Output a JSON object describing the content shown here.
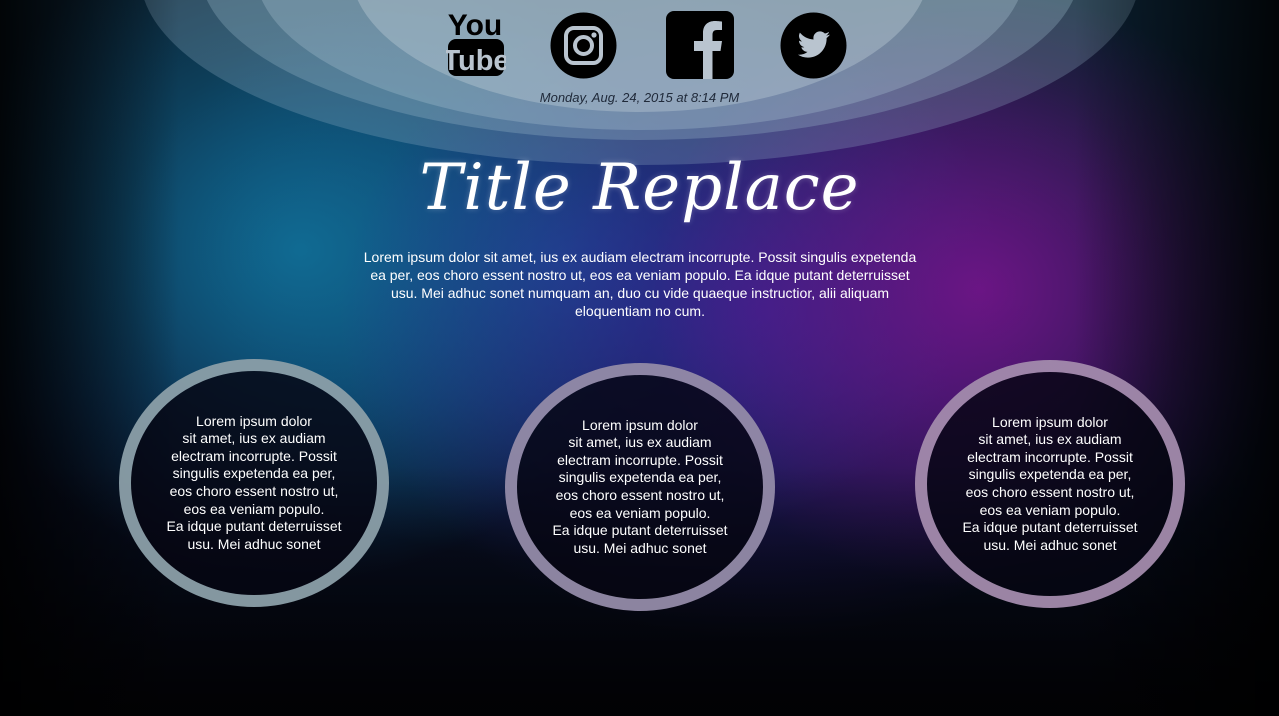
{
  "social": {
    "youtube": {
      "icon": "youtube-icon",
      "label_top": "You",
      "label_bottom": "Tube"
    },
    "instagram": {
      "icon": "instagram-icon"
    },
    "facebook": {
      "icon": "facebook-icon"
    },
    "twitter": {
      "icon": "twitter-icon"
    }
  },
  "header": {
    "timestamp": "Monday, Aug. 24, 2015 at 8:14 PM",
    "title": "Title Replace"
  },
  "intro": {
    "text": "Lorem ipsum dolor sit amet, ius ex audiam electram incorrupte. Possit singulis expetenda ea per, eos choro essent nostro ut, eos ea veniam populo. Ea idque putant deterruisset usu. Mei adhuc sonet numquam an, duo cu vide quaeque instructior, alii aliquam eloquentiam no cum."
  },
  "circles": [
    {
      "lines": [
        "Lorem ipsum dolor",
        "sit amet, ius ex audiam",
        "electram incorrupte. Possit",
        "singulis expetenda ea per,",
        "eos choro essent nostro ut,",
        "eos ea veniam populo.",
        "Ea idque putant deterruisset",
        "usu. Mei adhuc sonet"
      ]
    },
    {
      "lines": [
        "Lorem ipsum dolor",
        "sit amet, ius ex audiam",
        "electram incorrupte. Possit",
        "singulis expetenda ea per,",
        "eos choro essent nostro ut,",
        "eos ea veniam populo.",
        "Ea idque putant deterruisset",
        "usu. Mei adhuc sonet"
      ]
    },
    {
      "lines": [
        "Lorem ipsum dolor",
        "sit amet, ius ex audiam",
        "electram incorrupte. Possit",
        "singulis expetenda ea per,",
        "eos choro essent nostro ut,",
        "eos ea veniam populo.",
        "Ea idque putant deterruisset",
        "usu. Mei adhuc sonet"
      ]
    }
  ],
  "colors": {
    "icon": "#000000",
    "text": "#ffffff",
    "timestamp": "#202a3a"
  }
}
